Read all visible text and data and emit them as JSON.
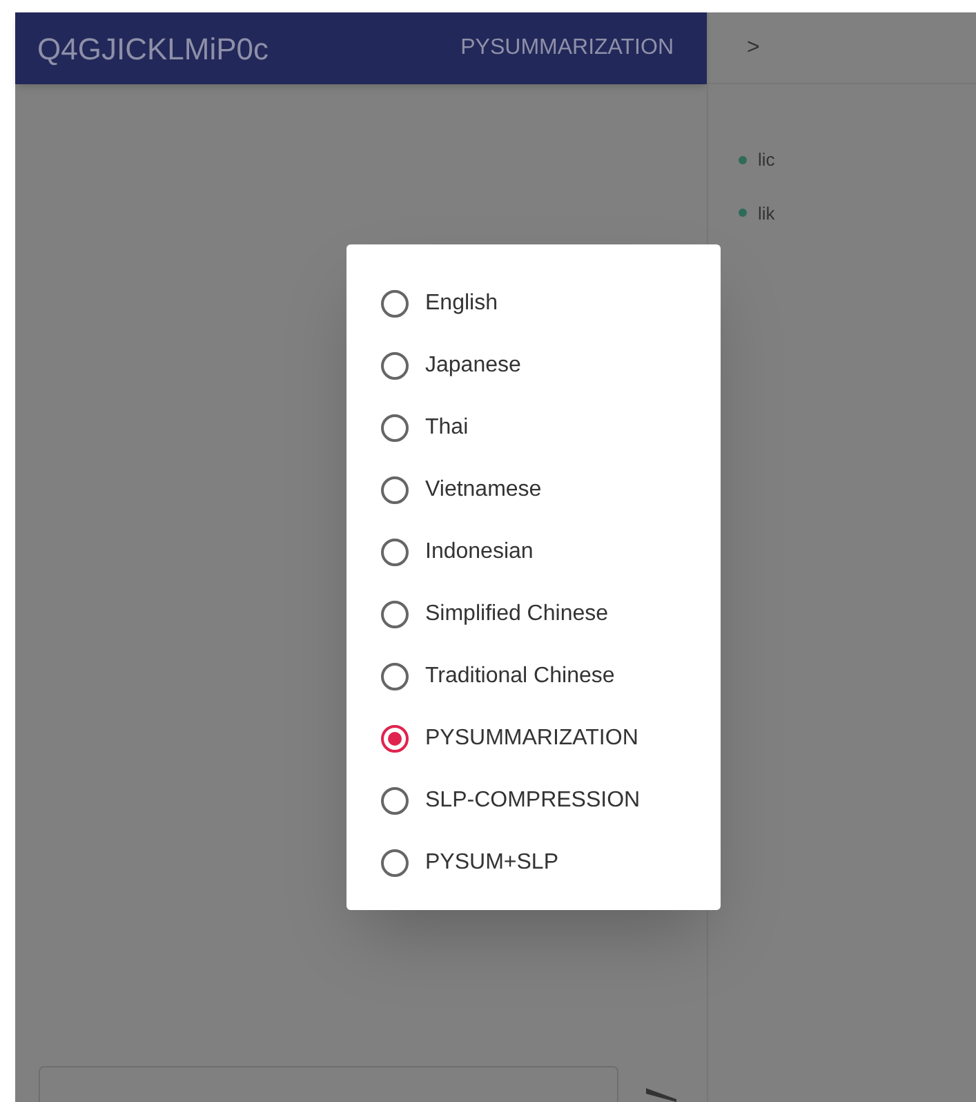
{
  "header": {
    "title": "Q4GJICKLMiP0c",
    "mode": "PYSUMMARIZATION"
  },
  "side_panel": {
    "toggle": ">",
    "items": [
      {
        "label": "lic"
      },
      {
        "label": "lik"
      }
    ]
  },
  "dialog": {
    "options": [
      {
        "label": "English",
        "selected": false
      },
      {
        "label": "Japanese",
        "selected": false
      },
      {
        "label": "Thai",
        "selected": false
      },
      {
        "label": "Vietnamese",
        "selected": false
      },
      {
        "label": "Indonesian",
        "selected": false
      },
      {
        "label": "Simplified Chinese",
        "selected": false
      },
      {
        "label": "Traditional Chinese",
        "selected": false
      },
      {
        "label": "PYSUMMARIZATION",
        "selected": true
      },
      {
        "label": "SLP-COMPRESSION",
        "selected": false
      },
      {
        "label": "PYSUM+SLP",
        "selected": false
      }
    ]
  }
}
